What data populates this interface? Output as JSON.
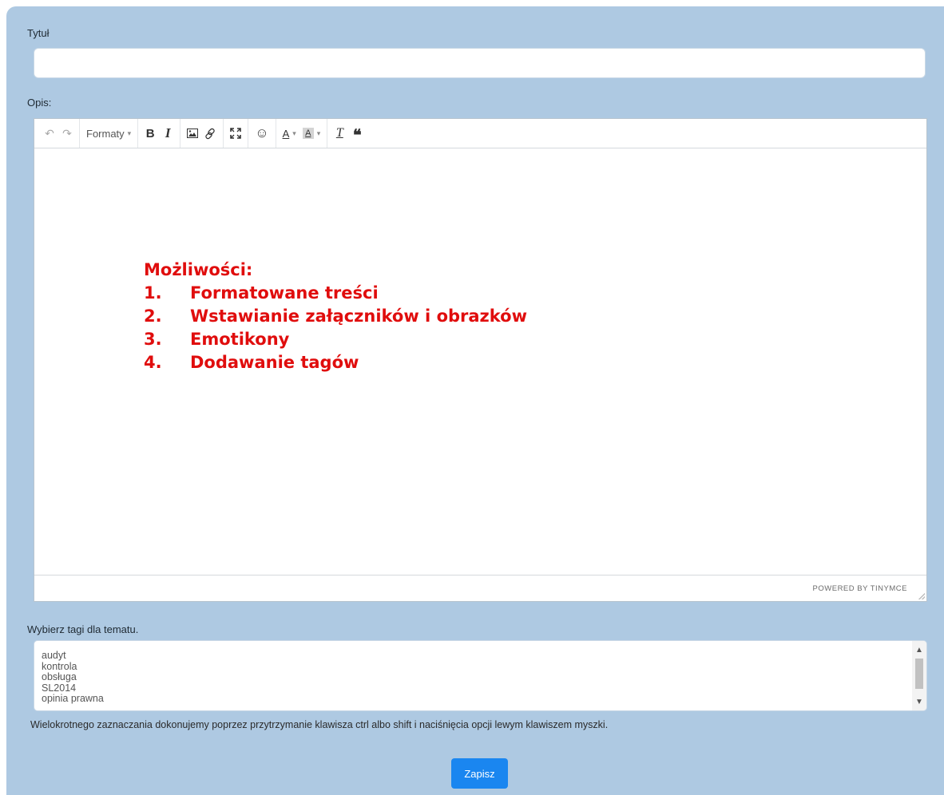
{
  "form": {
    "title_label": "Tytuł",
    "title_value": "",
    "description_label": "Opis:",
    "tags_label": "Wybierz tagi dla tematu.",
    "tags_hint": "Wielokrotnego zaznaczania dokonujemy poprzez przytrzymanie klawisza ctrl albo shift i naciśnięcia opcji lewym klawiszem myszki.",
    "save_label": "Zapisz"
  },
  "editor": {
    "toolbar": {
      "undo_icon": "↶",
      "redo_icon": "↷",
      "formats_label": "Formaty",
      "bold": "B",
      "italic": "I",
      "image_icon": "image-icon",
      "link_icon": "link-icon",
      "fullscreen_icon": "fullscreen-icon",
      "emoticon_icon": "☺",
      "text_color": "A",
      "bg_color": "A",
      "clear_format": "T",
      "blockquote": "❝"
    },
    "content": {
      "heading": "Możliwości:",
      "items": [
        {
          "num": "1.",
          "text": "Formatowane treści"
        },
        {
          "num": "2.",
          "text": "Wstawianie załączników i obrazków"
        },
        {
          "num": "3.",
          "text": "Emotikony"
        },
        {
          "num": "4.",
          "text": "Dodawanie tagów"
        }
      ],
      "color": "#e00d0d"
    },
    "powered_by": "POWERED BY TINYMCE"
  },
  "tags": {
    "options": [
      "audyt",
      "kontrola",
      "obsługa",
      "SL2014",
      "opinia prawna"
    ]
  },
  "colors": {
    "panel_bg": "#aec9e2",
    "accent": "#1a86f0"
  }
}
